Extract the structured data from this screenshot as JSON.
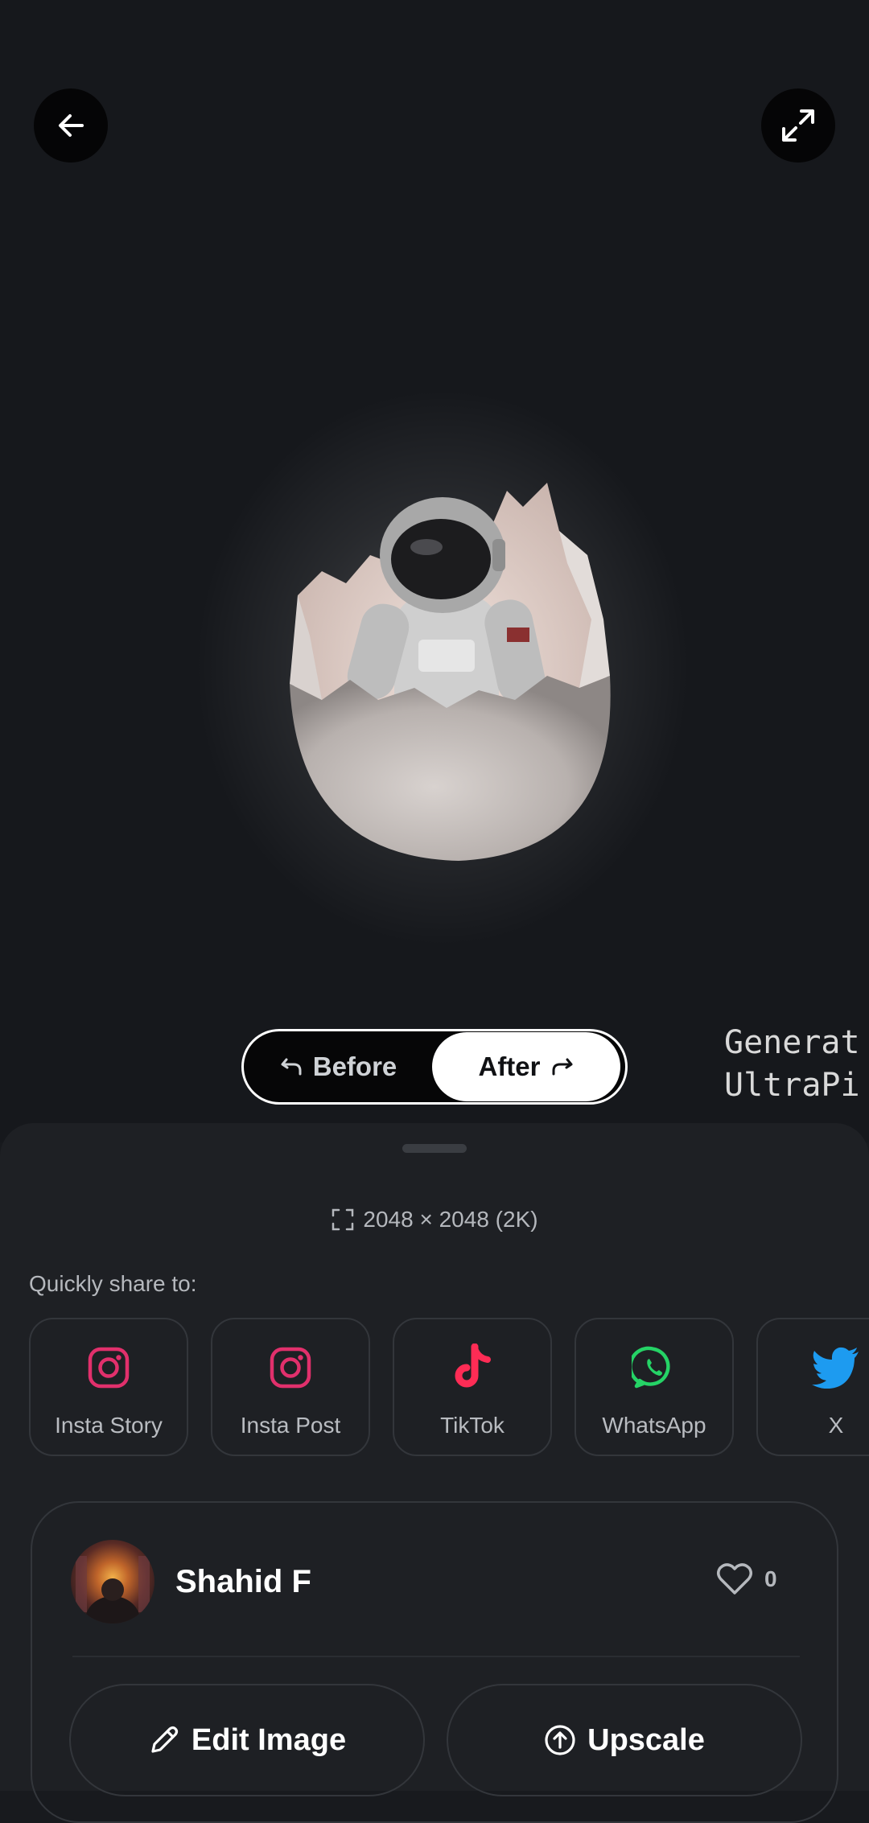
{
  "viewer": {
    "back_icon": "arrow-left-icon",
    "expand_icon": "expand-icon",
    "image_subject": "astronaut-in-egg",
    "compare": {
      "before_label": "Before",
      "after_label": "After",
      "selected": "After"
    },
    "watermark_line1": "Generat",
    "watermark_line2": "UltraPi"
  },
  "sheet": {
    "resolution": "2048 × 2048 (2K)",
    "share_label": "Quickly share to:",
    "share_targets": [
      {
        "label": "Insta Story",
        "icon": "instagram-icon",
        "color": "#e1306c"
      },
      {
        "label": "Insta Post",
        "icon": "instagram-icon",
        "color": "#e1306c"
      },
      {
        "label": "TikTok",
        "icon": "tiktok-icon",
        "color": "#fe2c55"
      },
      {
        "label": "WhatsApp",
        "icon": "whatsapp-icon",
        "color": "#25d366"
      },
      {
        "label": "X",
        "icon": "twitter-bird-icon",
        "color": "#1d9bf0"
      }
    ],
    "creator": {
      "name": "Shahid F",
      "likes": "0"
    },
    "actions": {
      "edit_label": "Edit Image",
      "upscale_label": "Upscale"
    }
  }
}
